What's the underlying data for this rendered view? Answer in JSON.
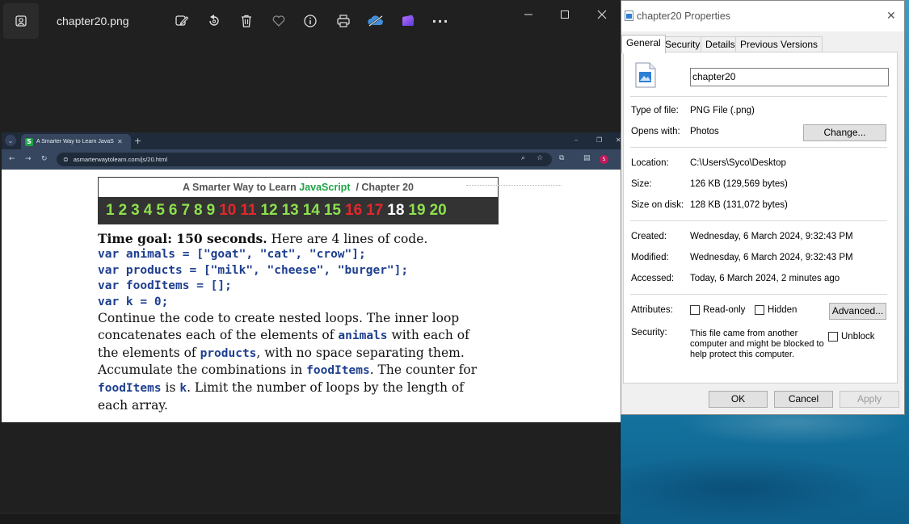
{
  "photos": {
    "file_title": "chapter20.png"
  },
  "browser": {
    "tab_title": "A Smarter Way to Learn JavaS",
    "tab_favicon": "S",
    "url": "asmarterwaytolearn.com/js/20.html",
    "profile_initial": "S"
  },
  "page": {
    "header_prefix": "A Smarter Way to Learn",
    "header_js": "JavaScript",
    "header_suffix": "/ Chapter 20",
    "chapters": [
      {
        "n": "1",
        "color": "#8ee04e"
      },
      {
        "n": "2",
        "color": "#8ee04e"
      },
      {
        "n": "3",
        "color": "#8ee04e"
      },
      {
        "n": "4",
        "color": "#8ee04e"
      },
      {
        "n": "5",
        "color": "#8ee04e"
      },
      {
        "n": "6",
        "color": "#8ee04e"
      },
      {
        "n": "7",
        "color": "#8ee04e"
      },
      {
        "n": "8",
        "color": "#8ee04e"
      },
      {
        "n": "9",
        "color": "#8ee04e"
      },
      {
        "n": "10",
        "color": "#e5262c"
      },
      {
        "n": "11",
        "color": "#e5262c"
      },
      {
        "n": "12",
        "color": "#8ee04e"
      },
      {
        "n": "13",
        "color": "#8ee04e"
      },
      {
        "n": "14",
        "color": "#8ee04e"
      },
      {
        "n": "15",
        "color": "#8ee04e"
      },
      {
        "n": "16",
        "color": "#e5262c"
      },
      {
        "n": "17",
        "color": "#e5262c"
      },
      {
        "n": "18",
        "color": "#ffffff"
      },
      {
        "n": "19",
        "color": "#8ee04e"
      },
      {
        "n": "20",
        "color": "#8ee04e"
      }
    ],
    "time_goal_bold": "Time goal: 150 seconds.",
    "time_goal_rest": " Here are 4 lines of code.",
    "code_lines": [
      "var animals = [\"goat\", \"cat\", \"crow\"];",
      "var products = [\"milk\", \"cheese\", \"burger\"];",
      "var foodItems = [];",
      "var k = 0;"
    ],
    "para": {
      "t1": "Continue the code to create nested loops. The inner loop concatenates each of the elements of ",
      "c1": "animals",
      "t2": " with each of the elements of ",
      "c2": "products",
      "t3": ", with no space separating them. Accumulate the combinations in ",
      "c3": "foodItems",
      "t4": ".  The counter for ",
      "c4": "foodItems",
      "t5": " is ",
      "c5": "k",
      "t6": ". Limit the number of loops by the length of each array."
    }
  },
  "properties": {
    "title": "chapter20 Properties",
    "tabs": [
      "General",
      "Security",
      "Details",
      "Previous Versions"
    ],
    "file_name": "chapter20",
    "type_label": "Type of file:",
    "type_value": "PNG File (.png)",
    "opens_label": "Opens with:",
    "opens_value": "Photos",
    "change_button": "Change...",
    "location_label": "Location:",
    "location_value": "C:\\Users\\Syco\\Desktop",
    "size_label": "Size:",
    "size_value": "126 KB (129,569 bytes)",
    "size_disk_label": "Size on disk:",
    "size_disk_value": "128 KB (131,072 bytes)",
    "created_label": "Created:",
    "created_value": "Wednesday, 6 March 2024, 9:32:43 PM",
    "modified_label": "Modified:",
    "modified_value": "Wednesday, 6 March 2024, 9:32:43 PM",
    "accessed_label": "Accessed:",
    "accessed_value": "Today, 6 March 2024, 2 minutes ago",
    "attributes_label": "Attributes:",
    "readonly_label": "Read-only",
    "hidden_label": "Hidden",
    "advanced_button": "Advanced...",
    "security_label": "Security:",
    "security_text": "This file came from another computer and might be blocked to help protect this computer.",
    "unblock_label": "Unblock",
    "ok_button": "OK",
    "cancel_button": "Cancel",
    "apply_button": "Apply"
  }
}
